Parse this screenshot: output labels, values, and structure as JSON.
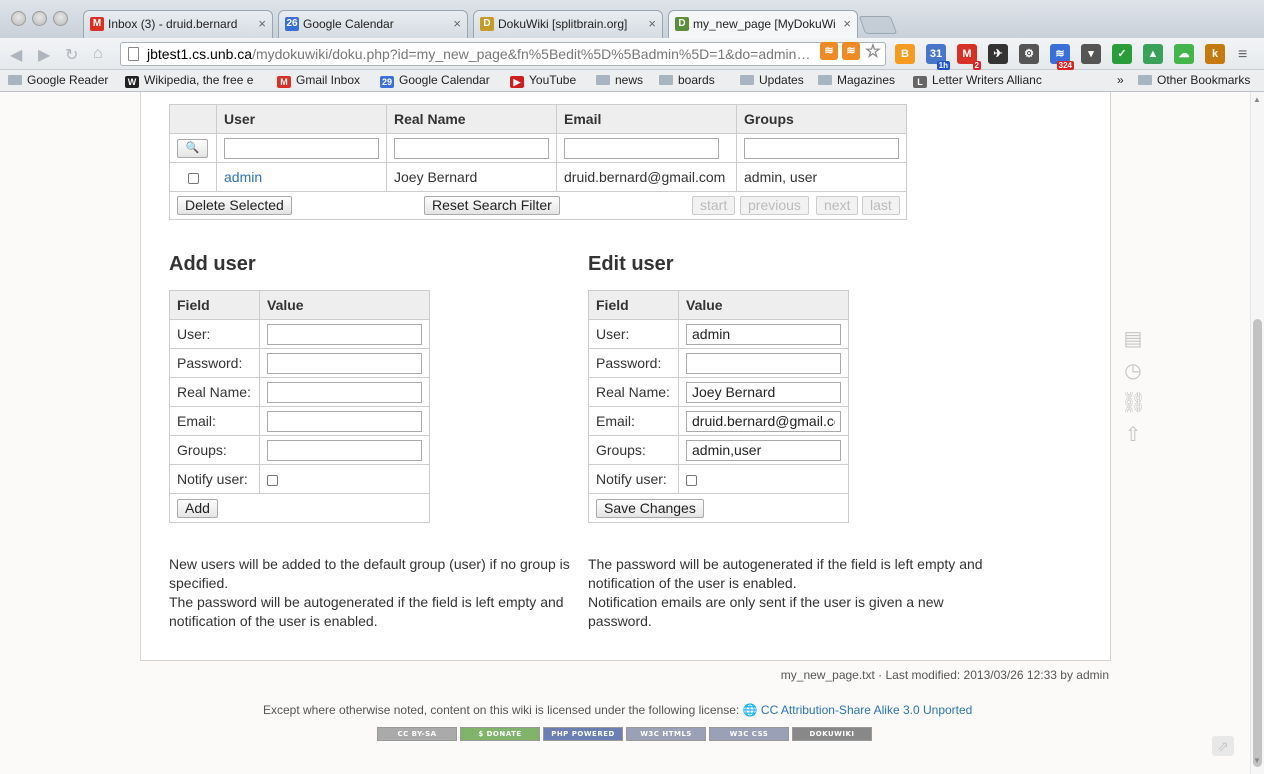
{
  "tabs": [
    {
      "label": "Inbox (3) - druid.bernard",
      "fav": "M",
      "fav_color": "#d93025"
    },
    {
      "label": "Google Calendar",
      "fav": "26",
      "fav_color": "#3a6fd8"
    },
    {
      "label": "DokuWiki [splitbrain.org]",
      "fav": "D",
      "fav_color": "#c49a28"
    },
    {
      "label": "my_new_page [MyDokuWi",
      "fav": "D",
      "fav_color": "#5c8f3a"
    }
  ],
  "address": {
    "host": "jbtest1.cs.unb.ca",
    "path": "/mydokuwiki/doku.php?id=my_new_page&fn%5Bedit%5D%5Badmin%5D=1&do=admin…"
  },
  "extensions": [
    {
      "name": "blogger-icon",
      "glyph": "B",
      "color": "#f49b20"
    },
    {
      "name": "calendar-checker-icon",
      "glyph": "31",
      "color": "#4a76c9",
      "badge": "1h",
      "badge_red": false
    },
    {
      "name": "gmail-checker-icon",
      "glyph": "M",
      "color": "#d93025",
      "badge": "2",
      "badge_red": true
    },
    {
      "name": "bird-icon",
      "glyph": "✈",
      "color": "#333333"
    },
    {
      "name": "gear-icon",
      "glyph": "⚙",
      "color": "#555555"
    },
    {
      "name": "rss-reader-icon",
      "glyph": "≋",
      "color": "#3a6fd8",
      "badge": "324",
      "badge_red": true
    },
    {
      "name": "pocket-icon",
      "glyph": "▾",
      "color": "#555555"
    },
    {
      "name": "checkmark-icon",
      "glyph": "✓",
      "color": "#2a9d3a"
    },
    {
      "name": "drive-icon",
      "glyph": "▲",
      "color": "#3aa15a"
    },
    {
      "name": "cloud-icon",
      "glyph": "☁",
      "color": "#44b54a"
    },
    {
      "name": "kindle-icon",
      "glyph": "k",
      "color": "#c47a10"
    }
  ],
  "bookmarks": [
    {
      "label": "Google Reader",
      "icon": "folder"
    },
    {
      "label": "Wikipedia, the free e",
      "icon": "W",
      "color": "#222222"
    },
    {
      "label": "Gmail Inbox",
      "icon": "M",
      "color": "#d93025"
    },
    {
      "label": "Google Calendar",
      "icon": "29",
      "color": "#3a6fd8"
    },
    {
      "label": "YouTube",
      "icon": "▶",
      "color": "#cc2020"
    },
    {
      "label": "news",
      "icon": "folder"
    },
    {
      "label": "boards",
      "icon": "folder"
    },
    {
      "label": "Updates",
      "icon": "folder"
    },
    {
      "label": "Magazines",
      "icon": "folder"
    },
    {
      "label": "Letter Writers Allianc",
      "icon": "L",
      "color": "#666666"
    },
    {
      "label": "»",
      "icon": "none"
    },
    {
      "label": "Other Bookmarks",
      "icon": "folder"
    }
  ],
  "userlist": {
    "headers": [
      "",
      "User",
      "Real Name",
      "Email",
      "Groups"
    ],
    "row": {
      "user": "admin",
      "real_name": "Joey Bernard",
      "email": "druid.bernard@gmail.com",
      "groups": "admin, user"
    },
    "delete_btn": "Delete Selected",
    "reset_btn": "Reset Search Filter",
    "pager": [
      "start",
      "previous",
      "next",
      "last"
    ]
  },
  "add_user": {
    "title": "Add user",
    "col_field": "Field",
    "col_value": "Value",
    "fields": [
      "User:",
      "Password:",
      "Real Name:",
      "Email:",
      "Groups:"
    ],
    "notify": "Notify user:",
    "button": "Add",
    "notes": [
      "New users will be added to the default group (user) if no group is specified.",
      "The password will be autogenerated if the field is left empty and notification of the user is enabled."
    ]
  },
  "edit_user": {
    "title": "Edit user",
    "col_field": "Field",
    "col_value": "Value",
    "fields": [
      "User:",
      "Password:",
      "Real Name:",
      "Email:",
      "Groups:"
    ],
    "values": [
      "admin",
      "",
      "Joey Bernard",
      "druid.bernard@gmail.cc",
      "admin,user"
    ],
    "notify": "Notify user:",
    "button": "Save Changes",
    "notes": [
      "The password will be autogenerated if the field is left empty and notification of the user is enabled.",
      "Notification emails are only sent if the user is given a new password."
    ]
  },
  "footer": {
    "pageinfo": "my_new_page.txt · Last modified: 2013/03/26 12:33 by admin",
    "license_text": "Except where otherwise noted, content on this wiki is licensed under the following license:",
    "license_link": "CC Attribution-Share Alike 3.0 Unported",
    "badges": [
      {
        "label": "CC BY-SA",
        "color": "#aaaaaa"
      },
      {
        "label": "$ DONATE",
        "color": "#7fb46a"
      },
      {
        "label": "PHP POWERED",
        "color": "#6b7fb3"
      },
      {
        "label": "W3C HTML5",
        "color": "#9aa0b5"
      },
      {
        "label": "W3C CSS",
        "color": "#9aa0b5"
      },
      {
        "label": "DOKUWIKI",
        "color": "#888888"
      }
    ]
  }
}
